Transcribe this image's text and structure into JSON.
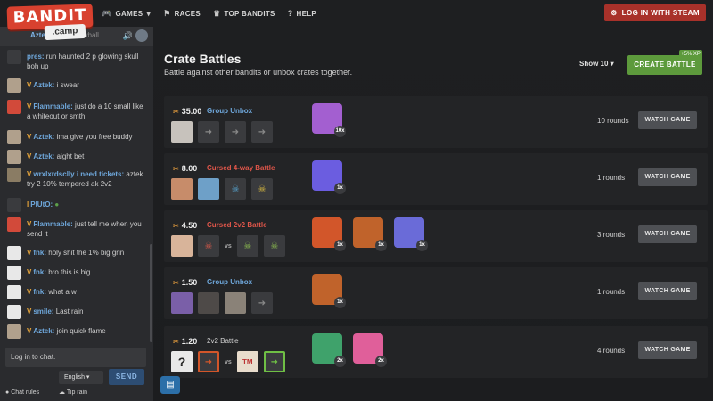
{
  "logo": {
    "main": "BANDIT",
    "sub": ".camp"
  },
  "nav": [
    {
      "label": "GAMES",
      "icon": "gamepad-icon"
    },
    {
      "label": "RACES",
      "icon": "flag-icon"
    },
    {
      "label": "TOP BANDITS",
      "icon": "crown-icon"
    },
    {
      "label": "HELP",
      "icon": "help-icon"
    }
  ],
  "auth": {
    "login_label": "LOG IN WITH STEAM"
  },
  "chat": {
    "header_name": "Aztek:",
    "header_text": "dip a snowball",
    "messages": [
      {
        "name": "pres:",
        "text": "run haunted 2 p glowing skull boh up",
        "level": ""
      },
      {
        "name": "Aztek:",
        "text": "i swear",
        "level": "V"
      },
      {
        "name": "Flammable:",
        "text": "just do a 10 small like a whiteout or smth",
        "level": "V"
      },
      {
        "name": "Aztek:",
        "text": "ima give you free buddy",
        "level": "V"
      },
      {
        "name": "Aztek:",
        "text": "aight bet",
        "level": "V"
      },
      {
        "name": "wrxlxrdsclly i need tickets:",
        "text": "aztek try 2 10% tempered ak 2v2",
        "level": "V"
      },
      {
        "name": "PIUtO:",
        "text": "",
        "level": "I"
      },
      {
        "name": "Flammable:",
        "text": "just tell me when you send it",
        "level": "V"
      },
      {
        "name": "fnk:",
        "text": "holy shit the 1% big grin",
        "level": "V"
      },
      {
        "name": "fnk:",
        "text": "bro this is big",
        "level": "V"
      },
      {
        "name": "fnk:",
        "text": "what a w",
        "level": "V"
      },
      {
        "name": "smile:",
        "text": "Last rain",
        "level": "V"
      },
      {
        "name": "Aztek:",
        "text": "join quick flame",
        "level": "V"
      }
    ],
    "input_placeholder": "Log in to chat.",
    "language": "English",
    "send_label": "SEND",
    "rules_label": "Chat rules",
    "tip_label": "Tip rain"
  },
  "page": {
    "title": "Crate Battles",
    "subtitle": "Battle against other bandits or unbox crates together.",
    "show_label": "Show 10",
    "create_label": "CREATE BATTLE",
    "xp_badge": "+5% XP"
  },
  "battles": [
    {
      "stake": "35.00",
      "mode": "Group Unbox",
      "mode_color": "#6fa8dc",
      "rounds": "10 rounds",
      "watch": "WATCH GAME",
      "crates": [
        {
          "qty": "10x",
          "color": "#a35fd0"
        }
      ]
    },
    {
      "stake": "8.00",
      "mode": "Cursed 4-way Battle",
      "mode_color": "#e0564a",
      "rounds": "1 rounds",
      "watch": "WATCH GAME",
      "crates": [
        {
          "qty": "1x",
          "color": "#6b5de0"
        }
      ]
    },
    {
      "stake": "4.50",
      "mode": "Cursed 2v2 Battle",
      "mode_color": "#e0564a",
      "rounds": "3 rounds",
      "watch": "WATCH GAME",
      "crates": [
        {
          "qty": "1x",
          "color": "#d2562a"
        },
        {
          "qty": "1x",
          "color": "#c0632b"
        },
        {
          "qty": "1x",
          "color": "#6a6bd8"
        }
      ]
    },
    {
      "stake": "1.50",
      "mode": "Group Unbox",
      "mode_color": "#6fa8dc",
      "rounds": "1 rounds",
      "watch": "WATCH GAME",
      "crates": [
        {
          "qty": "1x",
          "color": "#c0632b"
        }
      ]
    },
    {
      "stake": "1.20",
      "mode": "2v2 Battle",
      "mode_color": "#d0d0d0",
      "rounds": "4 rounds",
      "watch": "WATCH GAME",
      "crates": [
        {
          "qty": "2x",
          "color": "#3fa26b"
        },
        {
          "qty": "2x",
          "color": "#e05f9a"
        }
      ]
    }
  ]
}
